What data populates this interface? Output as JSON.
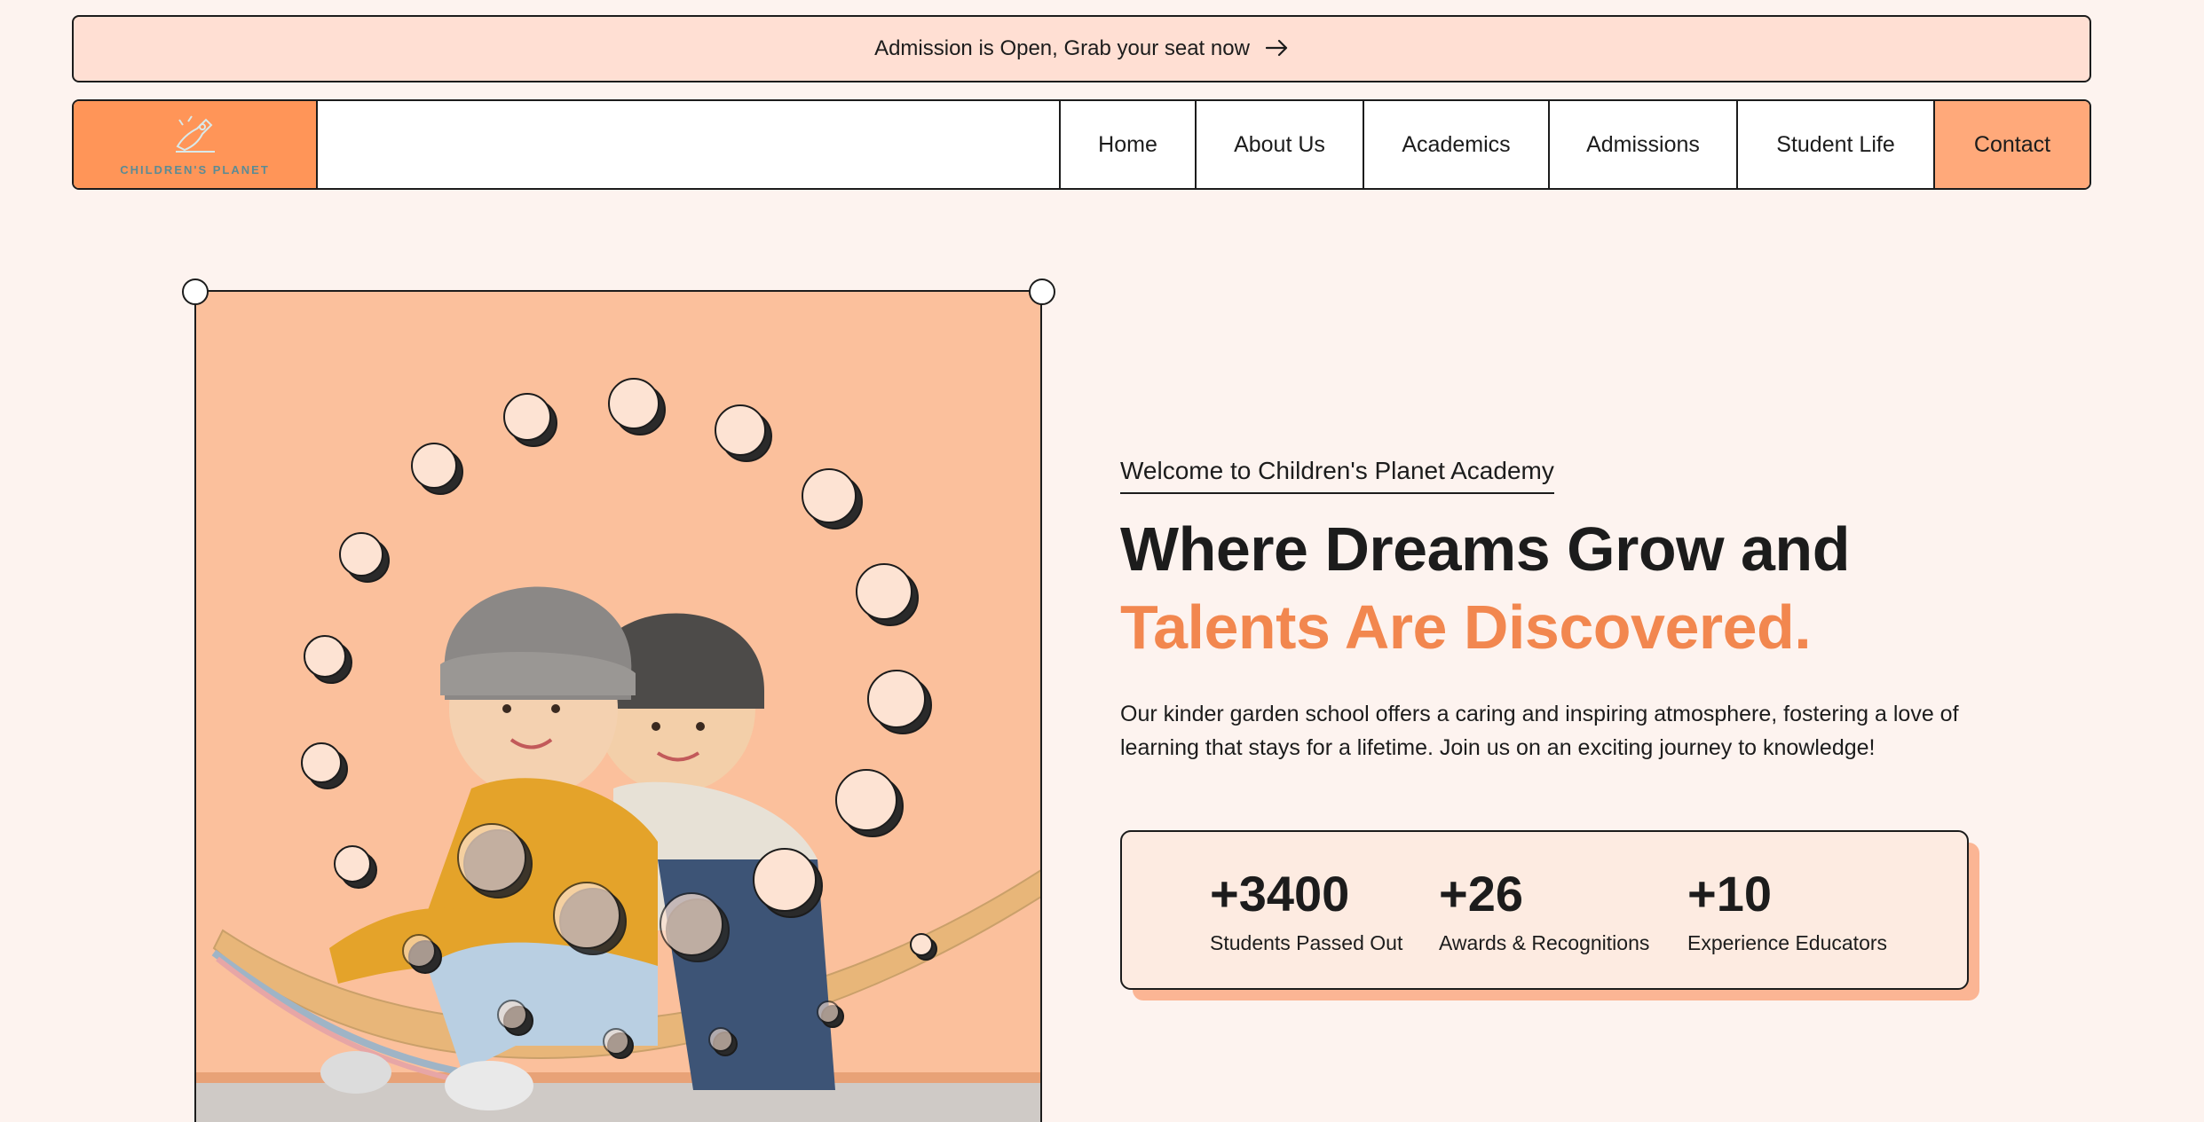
{
  "announcement": {
    "text": "Admission is Open, Grab your seat now",
    "arrow_icon": "arrow-right-icon"
  },
  "logo": {
    "text": "CHILDREN'S PLANET",
    "icon": "rocket-logo-icon"
  },
  "nav": {
    "items": [
      {
        "label": "Home"
      },
      {
        "label": "About Us"
      },
      {
        "label": "Academics"
      },
      {
        "label": "Admissions"
      },
      {
        "label": "Student Life"
      },
      {
        "label": "Contact"
      }
    ]
  },
  "hero": {
    "eyebrow": "Welcome to Children's Planet Academy",
    "headline_line1": "Where Dreams Grow and",
    "headline_line2": "Talents Are Discovered.",
    "intro": "Our kinder garden school offers a caring and inspiring atmosphere, fostering a love of learning that stays for a lifetime. Join us on an exciting journey to knowledge!"
  },
  "stats": [
    {
      "value": "+3400",
      "label": "Students Passed Out"
    },
    {
      "value": "+26",
      "label": "Awards & Recognitions"
    },
    {
      "value": "+10",
      "label": "Experience Educators"
    }
  ],
  "colors": {
    "accent": "#f2874f",
    "nav_logo_bg": "#ff9558",
    "contact_bg": "#ffa97a",
    "page_bg": "#fdf3ef",
    "announce_bg": "#ffdfd3",
    "hero_bg": "#fbc09c"
  }
}
